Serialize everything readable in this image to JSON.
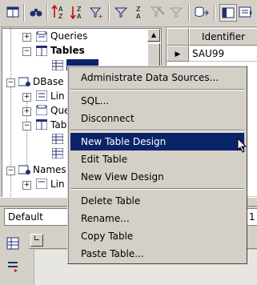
{
  "toolbar": {
    "icons": [
      "database-view-icon",
      "find-icon",
      "sort-ascending-icon",
      "sort-descending-icon",
      "auto-filter-icon",
      "filter-icon",
      "standard-filter-icon",
      "remove-filter-icon",
      "apply-filter-icon",
      "data-to-text-icon",
      "explorer-on-off-icon",
      "data-source-icon"
    ],
    "labels": {
      "az_up": "AZ",
      "az_down": "ZA",
      "za": "Z A"
    }
  },
  "tree": {
    "items": [
      {
        "label": "Queries",
        "expander": "+"
      },
      {
        "label": "Tables",
        "expander": "−"
      },
      {
        "label": "",
        "expander": ""
      },
      {
        "label": "DBase",
        "expander": "−"
      },
      {
        "label": "Lin",
        "expander": "+"
      },
      {
        "label": "Que",
        "expander": "+"
      },
      {
        "label": "Tab",
        "expander": "−"
      },
      {
        "label": "",
        "expander": ""
      },
      {
        "label": "",
        "expander": ""
      },
      {
        "label": "Names",
        "expander": "−"
      },
      {
        "label": "Lin",
        "expander": "+"
      }
    ]
  },
  "grid": {
    "column_header": "Identifier",
    "row_marker": "▶",
    "rows": [
      "SAU99"
    ]
  },
  "bottom": {
    "style_combo": "Default",
    "size_combo": "1"
  },
  "context_menu": {
    "items": [
      {
        "label": "Administrate Data Sources...",
        "active": false
      },
      {
        "label": "SQL...",
        "active": false
      },
      {
        "label": "Disconnect",
        "active": false
      },
      {
        "label": "New Table Design",
        "active": true
      },
      {
        "label": "Edit Table",
        "active": false
      },
      {
        "label": "New View Design",
        "active": false
      },
      {
        "label": "Delete Table",
        "active": false
      },
      {
        "label": "Rename...",
        "active": false
      },
      {
        "label": "Copy Table",
        "active": false
      },
      {
        "label": "Paste Table...",
        "active": false
      }
    ]
  },
  "colors": {
    "menu_highlight": "#0a246a",
    "face": "#d4d0c8"
  }
}
